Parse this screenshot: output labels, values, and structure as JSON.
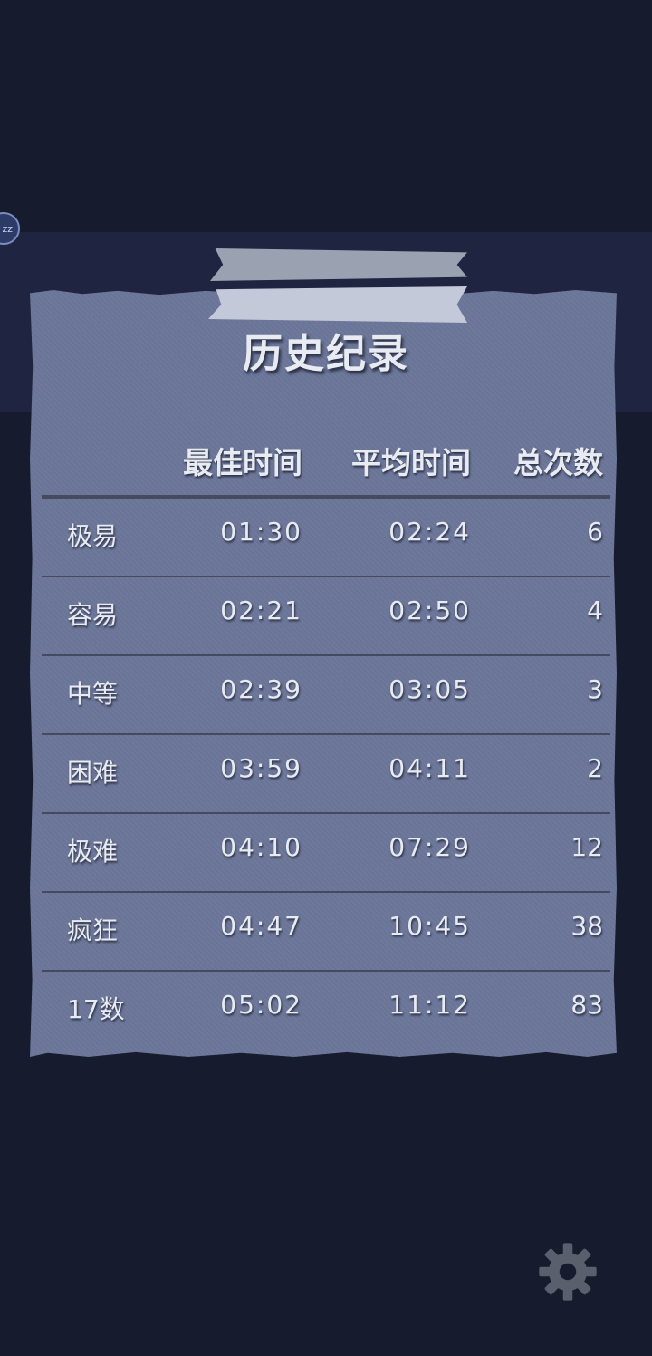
{
  "badge": {
    "text": "zz"
  },
  "title": "历史纪录",
  "columns": {
    "best": "最佳时间",
    "avg": "平均时间",
    "total": "总次数"
  },
  "rows": [
    {
      "level": "极易",
      "best": "01:30",
      "avg": "02:24",
      "total": "6"
    },
    {
      "level": "容易",
      "best": "02:21",
      "avg": "02:50",
      "total": "4"
    },
    {
      "level": "中等",
      "best": "02:39",
      "avg": "03:05",
      "total": "3"
    },
    {
      "level": "困难",
      "best": "03:59",
      "avg": "04:11",
      "total": "2"
    },
    {
      "level": "极难",
      "best": "04:10",
      "avg": "07:29",
      "total": "12"
    },
    {
      "level": "疯狂",
      "best": "04:47",
      "avg": "10:45",
      "total": "38"
    },
    {
      "level": "17数",
      "best": "05:02",
      "avg": "11:12",
      "total": "83"
    }
  ],
  "icons": {
    "settings": "gear-icon"
  },
  "colors": {
    "background": "#161b2d",
    "paper": "#6b7699",
    "tape": "#c4c9da"
  }
}
